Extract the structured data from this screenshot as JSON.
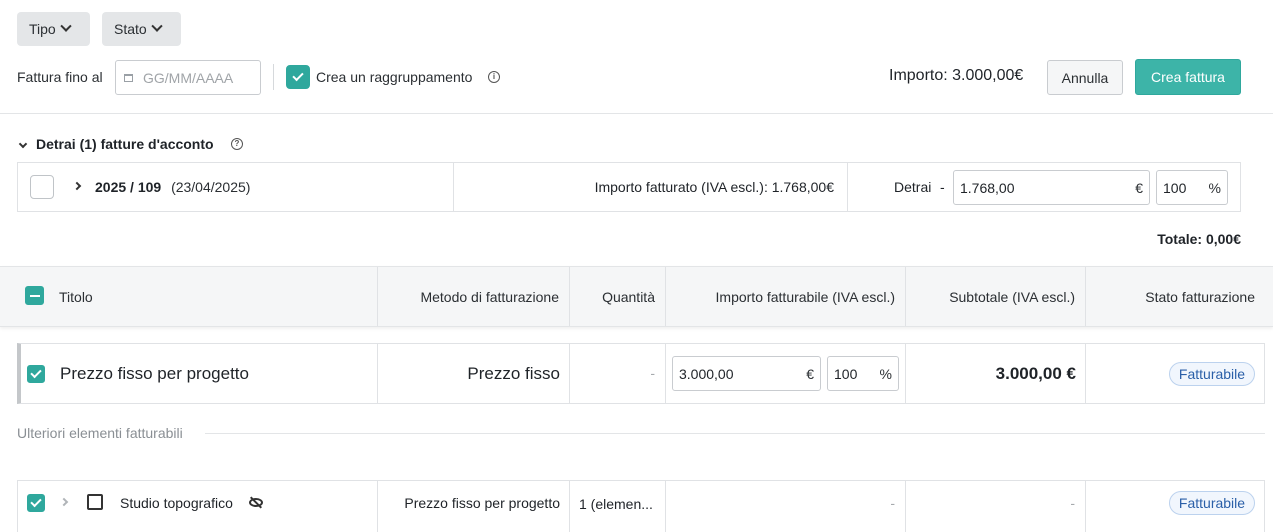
{
  "filters": {
    "type_label": "Tipo",
    "status_label": "Stato"
  },
  "invoice_until": {
    "label": "Fattura fino al",
    "placeholder": "GG/MM/AAAA"
  },
  "grouping": {
    "label": "Crea un raggruppamento",
    "checked": true
  },
  "amount": {
    "label": "Importo:",
    "value": "3.000,00€"
  },
  "actions": {
    "cancel": "Annulla",
    "create": "Crea fattura"
  },
  "deduct": {
    "title": "Detrai (1) fatture d'acconto",
    "invoice_number": "2025 / 109",
    "invoice_date": "(23/04/2025)",
    "invoiced_label": "Importo fatturato (IVA escl.): 1.768,00€",
    "deduct_label": "Detrai",
    "deduct_sign": "-",
    "deduct_amount": "1.768,00",
    "currency": "€",
    "percent": "100",
    "percent_unit": "%",
    "total": "Totale: 0,00€"
  },
  "table": {
    "columns": [
      "Titolo",
      "Metodo di fatturazione",
      "Quantità",
      "Importo fatturabile (IVA escl.)",
      "Subtotale (IVA escl.)",
      "Stato fatturazione"
    ]
  },
  "main_row": {
    "title": "Prezzo fisso per progetto",
    "method": "Prezzo fisso",
    "quantity": "-",
    "amount": "3.000,00",
    "currency": "€",
    "percent": "100",
    "percent_unit": "%",
    "subtotal": "3.000,00 €",
    "status": "Fatturabile"
  },
  "more_items_label": "Ulteriori elementi fatturabili",
  "item_row": {
    "title": "Studio topografico",
    "method": "Prezzo fisso per progetto",
    "quantity": "1 (elemen...",
    "amount": "-",
    "subtotal": "-",
    "status": "Fatturabile"
  },
  "colors": {
    "accent": "#3db4a8",
    "badge_text": "#2a5fa8"
  }
}
